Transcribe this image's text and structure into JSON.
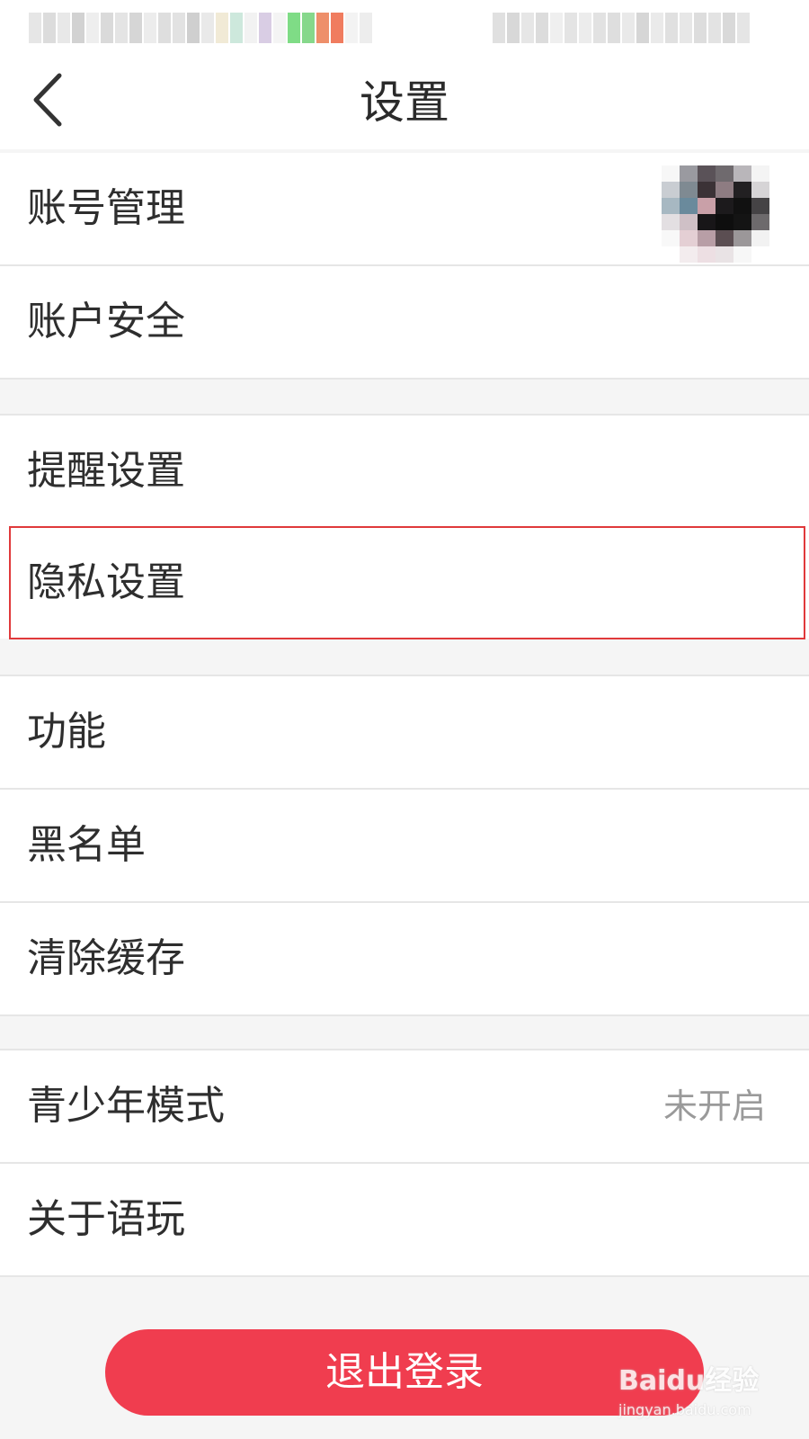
{
  "header": {
    "title": "设置",
    "back_icon": "chevron-left-icon"
  },
  "sections": {
    "account": [
      {
        "label": "账号管理",
        "has_avatar": true
      },
      {
        "label": "账户安全"
      }
    ],
    "settings": [
      {
        "label": "提醒设置"
      },
      {
        "label": "隐私设置",
        "highlighted": true
      }
    ],
    "general": [
      {
        "label": "功能"
      },
      {
        "label": "黑名单"
      },
      {
        "label": "清除缓存"
      }
    ],
    "misc": [
      {
        "label": "青少年模式",
        "value": "未开启"
      },
      {
        "label": "关于语玩"
      }
    ]
  },
  "logout": {
    "label": "退出登录"
  },
  "watermark": {
    "brand": "Baidu经验",
    "url": "jingyan.baidu.com"
  },
  "colors": {
    "accent": "#f03d4f",
    "highlight_border": "#e0393b",
    "background": "#f5f5f5",
    "row_background": "#ffffff"
  }
}
